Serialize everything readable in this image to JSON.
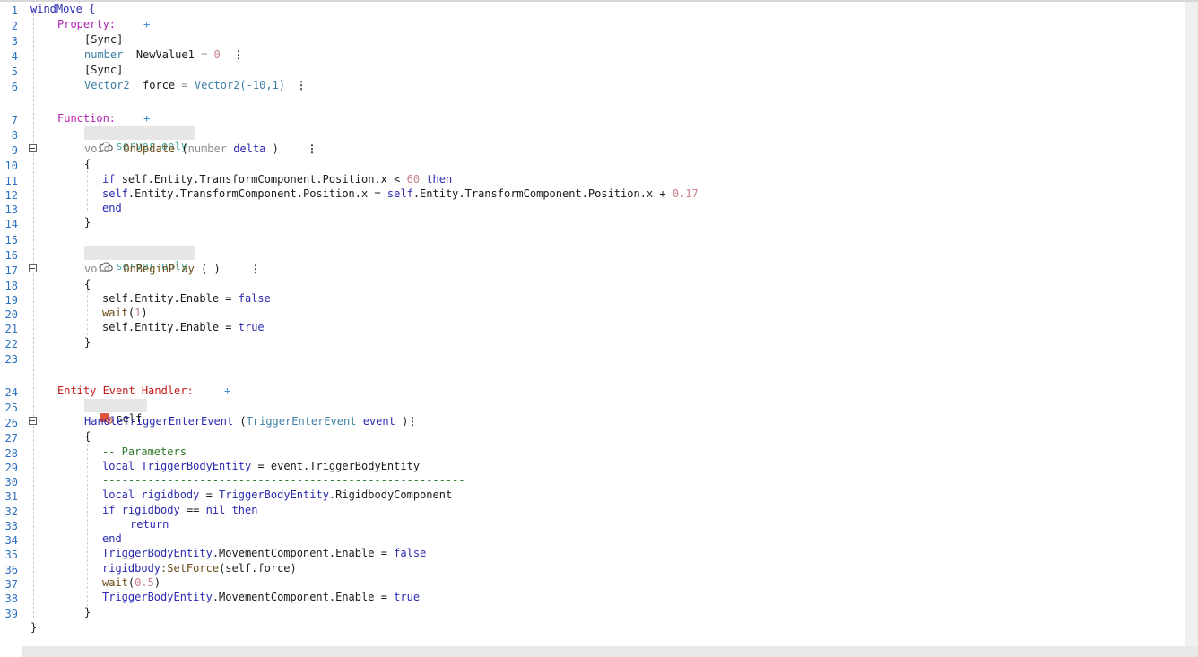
{
  "editor": {
    "line_numbers": [
      "1",
      "2",
      "3",
      "4",
      "5",
      "6",
      "7",
      "8",
      "9",
      "10",
      "11",
      "12",
      "13",
      "14",
      "15",
      "16",
      "17",
      "18",
      "19",
      "20",
      "21",
      "22",
      "23",
      "24",
      "25",
      "26",
      "27",
      "28",
      "29",
      "30",
      "31",
      "32",
      "33",
      "34",
      "35",
      "36",
      "37",
      "38",
      "39"
    ],
    "script_name": "windMove",
    "open_brace": "{",
    "close_brace": "}",
    "property": {
      "header": "Property:",
      "add": "+",
      "sync1": "[Sync]",
      "p1_type": "number",
      "p1_name": "NewValue1",
      "p1_eq": "=",
      "p1_value": "0",
      "sync2": "[Sync]",
      "p2_type": "Vector2",
      "p2_name": "force",
      "p2_eq": "=",
      "p2_value": "Vector2(-10,1)",
      "menu": "⋮"
    },
    "function": {
      "header": "Function:",
      "add": "+",
      "badge": "server only",
      "menu": "⋮",
      "f1": {
        "void": "void",
        "name": "OnUpdate",
        "open": "(",
        "param_type": "number",
        "param_name": "delta",
        "close": ")",
        "brace_open": "{",
        "brace_close": "}",
        "l11_if": "if",
        "l11_expr": "self.Entity.TransformComponent.Position.x",
        "l11_lt": "<",
        "l11_num": "60",
        "l11_then": "then",
        "l12_self1": "self",
        "l12_rest1": ".Entity.TransformComponent.Position.x",
        "l12_eq": "=",
        "l12_self2": "self",
        "l12_rest2": ".Entity.TransformComponent.Position.x",
        "l12_plus": "+",
        "l12_num": "0.17",
        "l13_end": "end"
      },
      "f2": {
        "void": "void",
        "name": "OnBeginPlay",
        "parens": "( )",
        "brace_open": "{",
        "brace_close": "}",
        "l19_stmt": "self.Entity.Enable",
        "l19_eq": "=",
        "l19_val": "false",
        "l20_fn": "wait",
        "l20_open": "(",
        "l20_num": "1",
        "l20_close": ")",
        "l21_stmt": "self.Entity.Enable",
        "l21_eq": "=",
        "l21_val": "true"
      }
    },
    "handler": {
      "header": "Entity Event Handler:",
      "add": "+",
      "badge": "self",
      "name": "HandleTriggerEnterEvent",
      "open": "(",
      "param_type": "TriggerEnterEvent",
      "param_name": "event",
      "close": ")",
      "menu": "⋮",
      "brace_open": "{",
      "brace_close": "}",
      "l28_comment": "-- Parameters",
      "l29_local": "local",
      "l29_name": "TriggerBodyEntity",
      "l29_eq": "=",
      "l29_val": "event.TriggerBodyEntity",
      "l30_sep": "--------------------------------------------------------",
      "l31_local": "local",
      "l31_name": "rigidbody",
      "l31_eq": "=",
      "l31_obj": "TriggerBodyEntity",
      "l31_prop": ".RigidbodyComponent",
      "l32_if": "if",
      "l32_name": "rigidbody",
      "l32_op": "==",
      "l32_nil": "nil",
      "l32_then": "then",
      "l33_return": "return",
      "l34_end": "end",
      "l35_obj": "TriggerBodyEntity",
      "l35_prop": ".MovementComponent.Enable",
      "l35_eq": "=",
      "l35_val": "false",
      "l36_obj": "rigidbody",
      "l36_method": ":SetForce",
      "l36_arg": "(self.force)",
      "l37_fn": "wait",
      "l37_open": "(",
      "l37_num": "0.5",
      "l37_close": ")",
      "l38_obj": "TriggerBodyEntity",
      "l38_prop": ".MovementComponent.Enable",
      "l38_eq": "=",
      "l38_val": "true"
    }
  }
}
